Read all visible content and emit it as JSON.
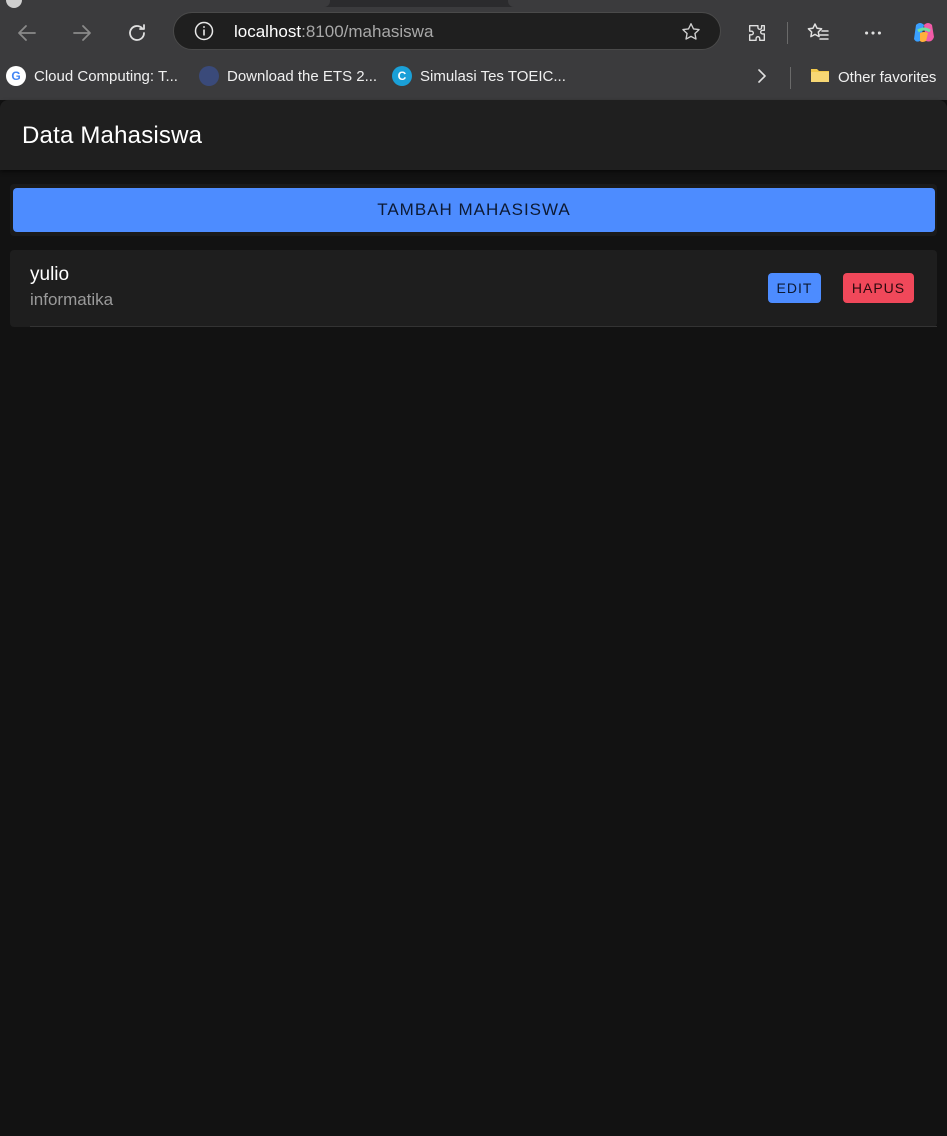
{
  "browser": {
    "url_host": "localhost",
    "url_path": ":8100/mahasiswa",
    "bookmarks": [
      {
        "label": "Cloud Computing: T..."
      },
      {
        "label": "Download the ETS 2..."
      },
      {
        "label": "Simulasi Tes TOEIC..."
      }
    ],
    "other_favorites": "Other favorites"
  },
  "app": {
    "title": "Data Mahasiswa",
    "add_button": "TAMBAH MAHASISWA",
    "students": [
      {
        "name": "yulio",
        "major": "informatika",
        "edit_label": "EDIT",
        "delete_label": "HAPUS"
      }
    ]
  },
  "colors": {
    "primary": "#4d8cff",
    "danger": "#f0485a",
    "background": "#121212"
  }
}
